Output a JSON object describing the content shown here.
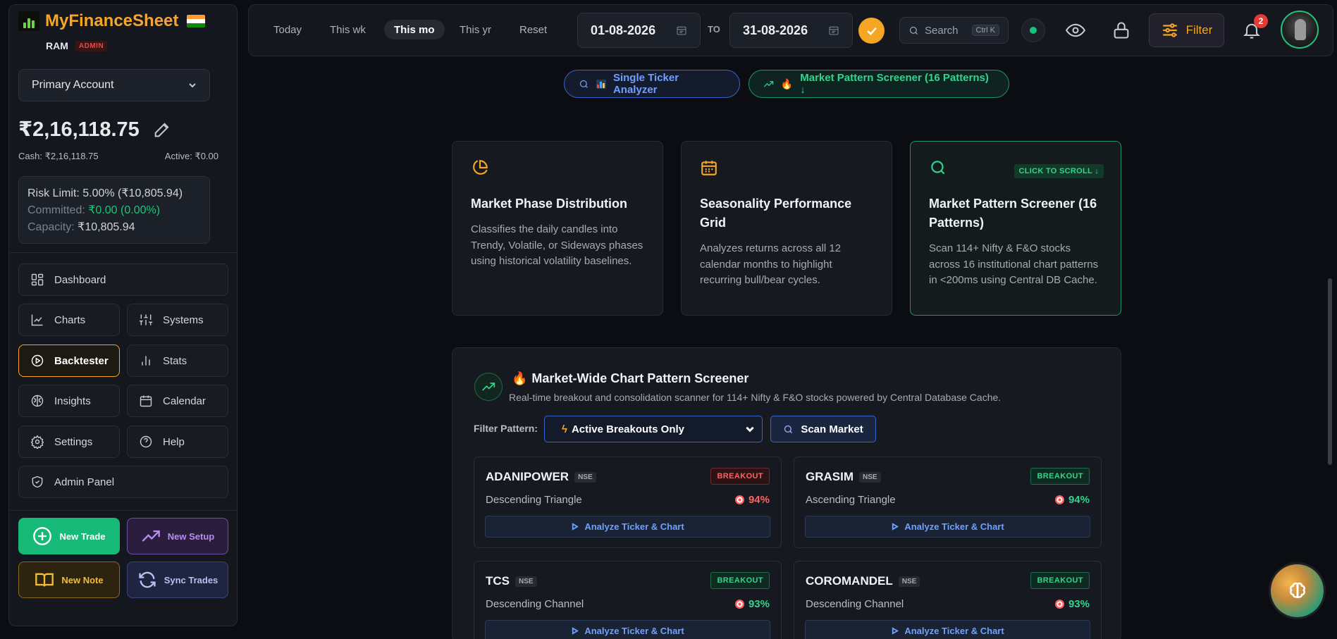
{
  "brand": {
    "title_my": "MyFinance",
    "title_rest": "Sheet",
    "user": "RAM",
    "role": "ADMIN"
  },
  "account": {
    "selected": "Primary Account",
    "balance": "₹2,16,118.75",
    "cash": "Cash: ₹2,16,118.75",
    "active": "Active: ₹0.00"
  },
  "risk": {
    "limit": "Risk Limit: 5.00% (₹10,805.94)",
    "committed_label": "Committed: ",
    "committed_value": "₹0.00 (0.00%)",
    "capacity_label": "Capacity: ",
    "capacity_value": "₹10,805.94"
  },
  "nav": {
    "dashboard": "Dashboard",
    "charts": "Charts",
    "systems": "Systems",
    "backtester": "Backtester",
    "stats": "Stats",
    "insights": "Insights",
    "calendar": "Calendar",
    "settings": "Settings",
    "help": "Help",
    "admin": "Admin Panel"
  },
  "actions": {
    "new_trade": "New Trade",
    "new_setup": "New Setup",
    "new_note": "New Note",
    "sync_trades": "Sync Trades"
  },
  "topbar": {
    "periods": [
      "Today",
      "This wk",
      "This mo",
      "This yr",
      "Reset"
    ],
    "active_period": "This mo",
    "date_from": "01-08-2026",
    "to": "TO",
    "date_to": "31-08-2026",
    "search": "Search",
    "search_kbd": "Ctrl K",
    "filter": "Filter",
    "notifications": "2"
  },
  "tabs": {
    "single": "Single Ticker Analyzer",
    "market": "Market Pattern Screener (16 Patterns) ↓"
  },
  "features": [
    {
      "title": "Market Phase Distribution",
      "desc": "Classifies the daily candles into Trendy, Volatile, or Sideways phases using historical volatility baselines."
    },
    {
      "title": "Seasonality Performance Grid",
      "desc": "Analyzes returns across all 12 calendar months to highlight recurring bull/bear cycles."
    },
    {
      "title": "Market Pattern Screener (16 Patterns)",
      "desc": "Scan 114+ Nifty & F&O stocks across 16 institutional chart patterns in <200ms using Central DB Cache.",
      "tag": "CLICK TO SCROLL ↓"
    }
  ],
  "screener": {
    "title": "Market-Wide Chart Pattern Screener",
    "subtitle": "Real-time breakout and consolidation scanner for 114+ Nifty & F&O stocks powered by Central Database Cache.",
    "filter_label": "Filter Pattern:",
    "filter_value": "Active Breakouts Only",
    "scan": "Scan Market",
    "analyze": "Analyze Ticker & Chart",
    "stocks": [
      {
        "name": "ADANIPOWER",
        "exchange": "NSE",
        "badge": "BREAKOUT",
        "pattern": "Descending Triangle",
        "confidence": "94%",
        "tone": "red"
      },
      {
        "name": "GRASIM",
        "exchange": "NSE",
        "badge": "BREAKOUT",
        "pattern": "Ascending Triangle",
        "confidence": "94%",
        "tone": "green"
      },
      {
        "name": "TCS",
        "exchange": "NSE",
        "badge": "BREAKOUT",
        "pattern": "Descending Channel",
        "confidence": "93%",
        "tone": "green"
      },
      {
        "name": "COROMANDEL",
        "exchange": "NSE",
        "badge": "BREAKOUT",
        "pattern": "Descending Channel",
        "confidence": "93%",
        "tone": "green"
      }
    ]
  },
  "colors": {
    "accent": "#f5a623",
    "green": "#1fc37a",
    "blue": "#3b63c9",
    "red": "#ff6262"
  }
}
